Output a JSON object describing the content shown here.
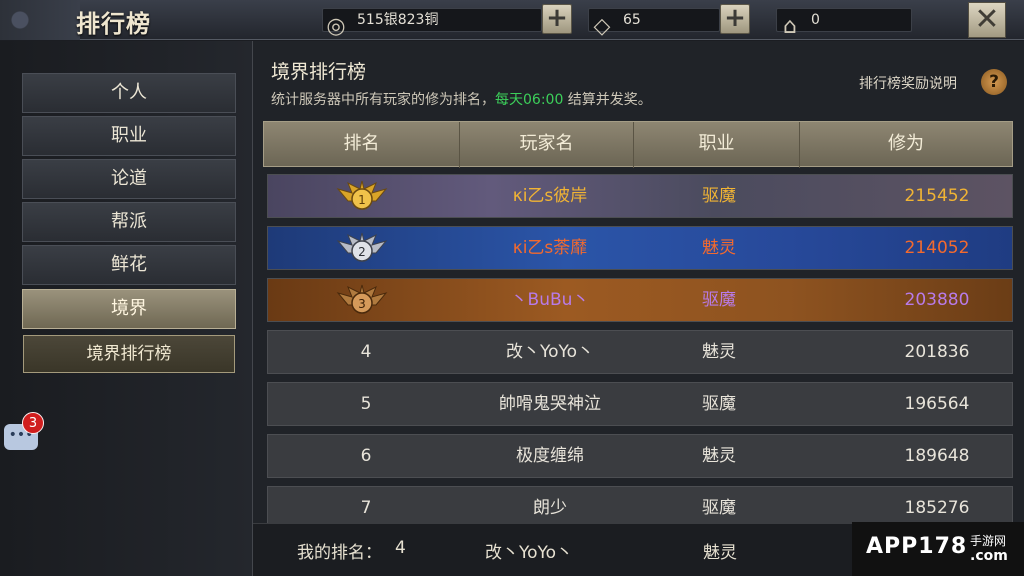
{
  "header": {
    "title": "排行榜",
    "currency": "515银823铜",
    "gems": "65",
    "tickets": "0"
  },
  "sidebar": {
    "items": [
      {
        "label": "个人"
      },
      {
        "label": "职业"
      },
      {
        "label": "论道"
      },
      {
        "label": "帮派"
      },
      {
        "label": "鲜花"
      },
      {
        "label": "境界"
      }
    ],
    "subitem": "境界排行榜",
    "chat_badge": "3"
  },
  "main": {
    "title": "境界排行榜",
    "desc_pre": "统计服务器中所有玩家的修为排名，",
    "desc_time": "每天06:00",
    "desc_post": " 结算并发奖。",
    "help": "排行榜奖励说明",
    "columns": [
      "排名",
      "玩家名",
      "职业",
      "修为"
    ],
    "rows": [
      {
        "rank": "1",
        "name": "κi乙s彼岸",
        "job": "驱魔",
        "score": "215452"
      },
      {
        "rank": "2",
        "name": "κi乙s荼靡",
        "job": "魅灵",
        "score": "214052"
      },
      {
        "rank": "3",
        "name": "丶BuBu丶",
        "job": "驱魔",
        "score": "203880"
      },
      {
        "rank": "4",
        "name": "改丶YoYo丶",
        "job": "魅灵",
        "score": "201836"
      },
      {
        "rank": "5",
        "name": "帥嗗鬼哭神泣",
        "job": "驱魔",
        "score": "196564"
      },
      {
        "rank": "6",
        "name": "极度缠绵",
        "job": "魅灵",
        "score": "189648"
      },
      {
        "rank": "7",
        "name": "朗少",
        "job": "驱魔",
        "score": "185276"
      }
    ],
    "my_rank_label": "我的排名：",
    "my_rank": "4",
    "my_name": "改丶YoYo丶",
    "my_job": "魅灵"
  },
  "watermark": {
    "text": "APP178",
    "sub_top": "手游网",
    "sub_bottom": ".com"
  }
}
